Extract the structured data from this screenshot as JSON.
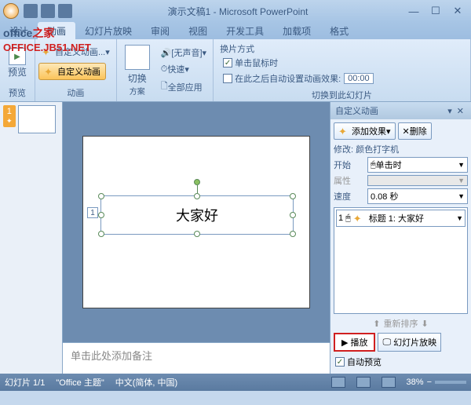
{
  "titlebar": {
    "title": "演示文稿1 - Microsoft PowerPoint"
  },
  "tabs": {
    "design": "设计",
    "animation": "动画",
    "slideshow": "幻灯片放映",
    "review": "审阅",
    "view": "视图",
    "developer": "开发工具",
    "addins": "加载项",
    "format": "格式"
  },
  "ribbon": {
    "preview_label": "预览",
    "preview_group": "预览",
    "custom_anim_label": "自定义动画...",
    "custom_anim_menu": "自定义动画",
    "animation_group": "动画",
    "switch_label": "切换",
    "scheme": "方案",
    "sound_label": "[无声音]",
    "speed_label": "快速",
    "apply_all": "全部应用",
    "transition_title": "换片方式",
    "on_click": "单击鼠标时",
    "auto_after": "在此之后自动设置动画效果:",
    "auto_time": "00:00",
    "transition_group": "切换到此幻灯片"
  },
  "slide": {
    "number": "1",
    "anim_tag": "1",
    "textbox_content": "大家好"
  },
  "notes": {
    "placeholder": "单击此处添加备注"
  },
  "taskpane": {
    "title": "自定义动画",
    "add_effect": "添加效果",
    "remove": "删除",
    "modify_label": "修改: 颜色打字机",
    "start_label": "开始",
    "start_value": "单击时",
    "property_label": "属性",
    "speed_label": "速度",
    "speed_value": "0.08 秒",
    "effects": [
      {
        "index": "1",
        "label": "标题 1: 大家好"
      }
    ],
    "reorder": "重新排序",
    "play": "播放",
    "slideshow": "幻灯片放映",
    "auto_preview": "自动预览"
  },
  "statusbar": {
    "slide_count": "幻灯片 1/1",
    "theme": "\"Office 主题\"",
    "lang": "中文(简体, 中国)",
    "zoom": "38%"
  },
  "watermark": {
    "line1a": "office",
    "line1b": "之家",
    "line2": "OFFICE.JB51.NET"
  }
}
